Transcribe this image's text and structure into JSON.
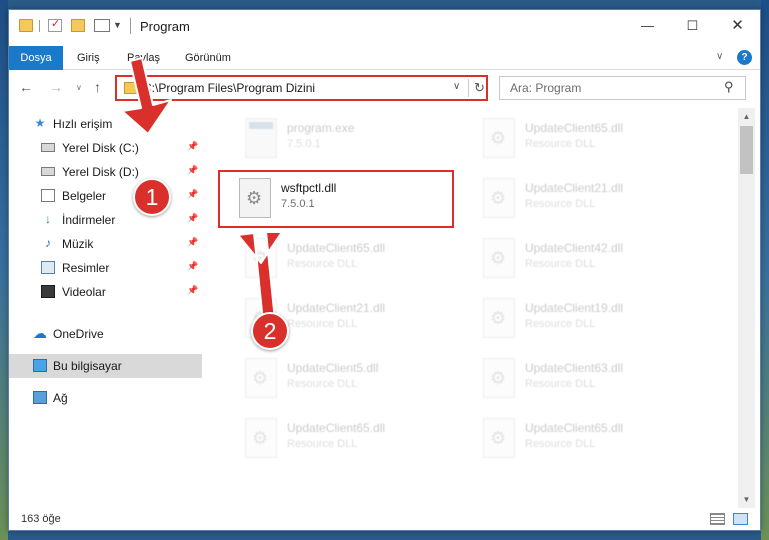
{
  "window": {
    "title": "Program",
    "minimize_glyph": "—",
    "maximize_glyph": "☐",
    "close_glyph": "✕"
  },
  "ribbon": {
    "tabs": [
      {
        "label": "Dosya"
      },
      {
        "label": "Giriş"
      },
      {
        "label": "Paylaş"
      },
      {
        "label": "Görünüm"
      }
    ],
    "help_glyph": "?"
  },
  "navigation": {
    "back_glyph": "←",
    "forward_glyph": "→",
    "up_glyph": "↑",
    "address": "C:\\Program Files\\Program Dizini",
    "refresh_glyph": "↻",
    "search_placeholder": "Ara: Program"
  },
  "sidebar": {
    "items": [
      {
        "label": "Hızlı erişim",
        "icon": "star-icon",
        "pinned": false
      },
      {
        "label": "Yerel Disk (C:)",
        "icon": "drive-icon",
        "pinned": true
      },
      {
        "label": "Yerel Disk (D:)",
        "icon": "drive-icon",
        "pinned": true
      },
      {
        "label": "Belgeler",
        "icon": "documents-icon",
        "pinned": true
      },
      {
        "label": "İndirmeler",
        "icon": "downloads-icon",
        "pinned": true
      },
      {
        "label": "Müzik",
        "icon": "music-icon",
        "pinned": true
      },
      {
        "label": "Resimler",
        "icon": "pictures-icon",
        "pinned": true
      },
      {
        "label": "Videolar",
        "icon": "videos-icon",
        "pinned": true
      },
      {
        "label": "OneDrive",
        "icon": "onedrive-icon",
        "pinned": false
      },
      {
        "label": "Bu bilgisayar",
        "icon": "this-pc-icon",
        "pinned": false,
        "selected": true
      },
      {
        "label": "Ağ",
        "icon": "network-icon",
        "pinned": false
      }
    ]
  },
  "files": [
    {
      "name": "program.exe",
      "subtitle": "7.5.0.1",
      "highlighted": false
    },
    {
      "name": "UpdateClient65.dll",
      "subtitle": "Resource DLL",
      "highlighted": false
    },
    {
      "name": "wsftpctl.dll",
      "subtitle": "7.5.0.1",
      "highlighted": true
    },
    {
      "name": "UpdateClient21.dll",
      "subtitle": "Resource DLL",
      "highlighted": false
    },
    {
      "name": "UpdateClient65.dll",
      "subtitle": "Resource DLL",
      "highlighted": false
    },
    {
      "name": "UpdateClient42.dll",
      "subtitle": "Resource DLL",
      "highlighted": false
    },
    {
      "name": "UpdateClient21.dll",
      "subtitle": "Resource DLL",
      "highlighted": false
    },
    {
      "name": "UpdateClient19.dll",
      "subtitle": "Resource DLL",
      "highlighted": false
    },
    {
      "name": "UpdateClient5.dll",
      "subtitle": "Resource DLL",
      "highlighted": false
    },
    {
      "name": "UpdateClient63.dll",
      "subtitle": "Resource DLL",
      "highlighted": false
    },
    {
      "name": "UpdateClient65.dll",
      "subtitle": "Resource DLL",
      "highlighted": false
    },
    {
      "name": "UpdateClient65.dll",
      "subtitle": "Resource DLL",
      "highlighted": false
    }
  ],
  "status": {
    "item_count": "163 öğe"
  },
  "annotations": {
    "callout_1": "1",
    "callout_2": "2",
    "color": "#d9302c"
  },
  "colors": {
    "accent": "#1979ca",
    "highlight_border": "#d9302c",
    "selected_row": "#d9d9d9"
  }
}
